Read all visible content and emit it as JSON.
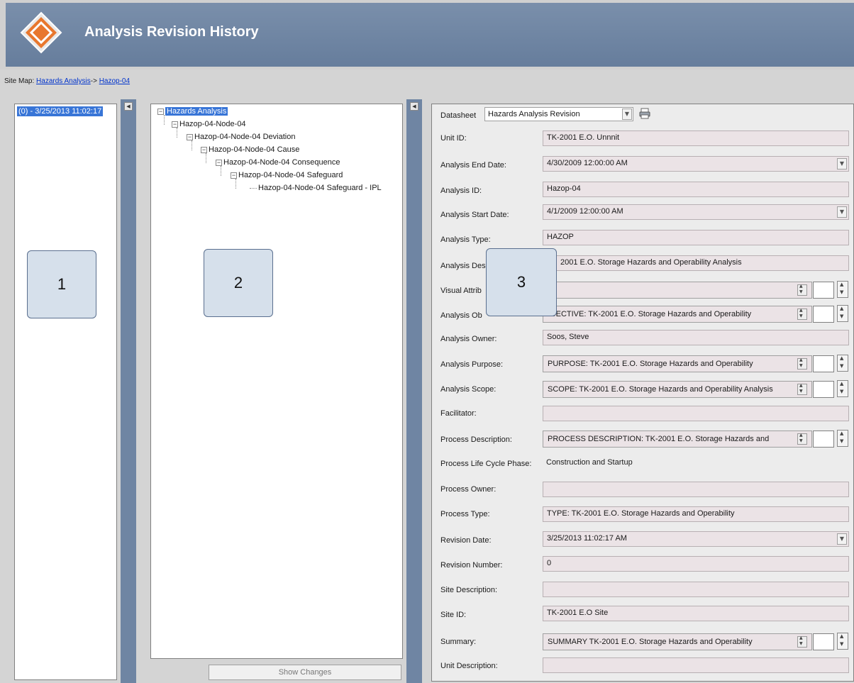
{
  "header": {
    "title": "Analysis Revision History"
  },
  "sitemap": {
    "prefix": "Site Map: ",
    "link1": "Hazards Analysis",
    "sep": "-> ",
    "link2": "Hazop-04"
  },
  "revisions": {
    "selected": "(0) - 3/25/2013 11:02:17"
  },
  "callouts": {
    "c1": "1",
    "c2": "2",
    "c3": "3"
  },
  "tree": {
    "root": "Hazards Analysis",
    "n1": "Hazop-04-Node-04",
    "n2": "Hazop-04-Node-04  Deviation",
    "n3": "Hazop-04-Node-04 Cause",
    "n4": "Hazop-04-Node-04 Consequence",
    "n5": "Hazop-04-Node-04 Safeguard",
    "n6": "Hazop-04-Node-04 Safeguard - IPL"
  },
  "show_changes": "Show Changes",
  "datasheet": {
    "label": "Datasheet",
    "value": "Hazards Analysis Revision"
  },
  "fields": {
    "unit_id": {
      "label": "Unit ID:",
      "value": "TK-2001 E.O. Unnnit"
    },
    "end_date": {
      "label": "Analysis End Date:",
      "value": "4/30/2009 12:00:00 AM"
    },
    "analysis_id": {
      "label": "Analysis ID:",
      "value": "Hazop-04"
    },
    "start_date": {
      "label": "Analysis Start Date:",
      "value": "4/1/2009 12:00:00 AM"
    },
    "type": {
      "label": "Analysis Type:",
      "value": "HAZOP"
    },
    "desc": {
      "label": "Analysis Des",
      "value": "2001 E.O. Storage Hazards and Operability Analysis"
    },
    "visual": {
      "label": "Visual Attrib",
      "value": ""
    },
    "objective": {
      "label": "Analysis Ob",
      "value": "3JECTIVE: TK-2001 E.O. Storage Hazards and Operability"
    },
    "owner": {
      "label": "Analysis Owner:",
      "value": "Soos, Steve"
    },
    "purpose": {
      "label": "Analysis Purpose:",
      "value": "PURPOSE: TK-2001 E.O. Storage Hazards and Operability"
    },
    "scope": {
      "label": "Analysis Scope:",
      "value": "SCOPE: TK-2001 E.O. Storage Hazards and Operability Analysis"
    },
    "facilitator": {
      "label": "Facilitator:",
      "value": ""
    },
    "proc_desc": {
      "label": "Process Description:",
      "value": "PROCESS DESCRIPTION: TK-2001 E.O. Storage Hazards and"
    },
    "life_cycle": {
      "label": "Process Life Cycle Phase:",
      "value": "Construction and Startup"
    },
    "proc_owner": {
      "label": "Process Owner:",
      "value": ""
    },
    "proc_type": {
      "label": "Process Type:",
      "value": "TYPE: TK-2001 E.O. Storage Hazards and Operability"
    },
    "rev_date": {
      "label": "Revision Date:",
      "value": "3/25/2013 11:02:17 AM"
    },
    "rev_num": {
      "label": "Revision Number:",
      "value": "0"
    },
    "site_desc": {
      "label": "Site Description:",
      "value": ""
    },
    "site_id": {
      "label": "Site ID:",
      "value": "TK-2001 E.O Site"
    },
    "summary": {
      "label": "Summary:",
      "value": "SUMMARY TK-2001 E.O. Storage Hazards and Operability"
    },
    "unit_desc": {
      "label": "Unit Description:",
      "value": ""
    }
  }
}
